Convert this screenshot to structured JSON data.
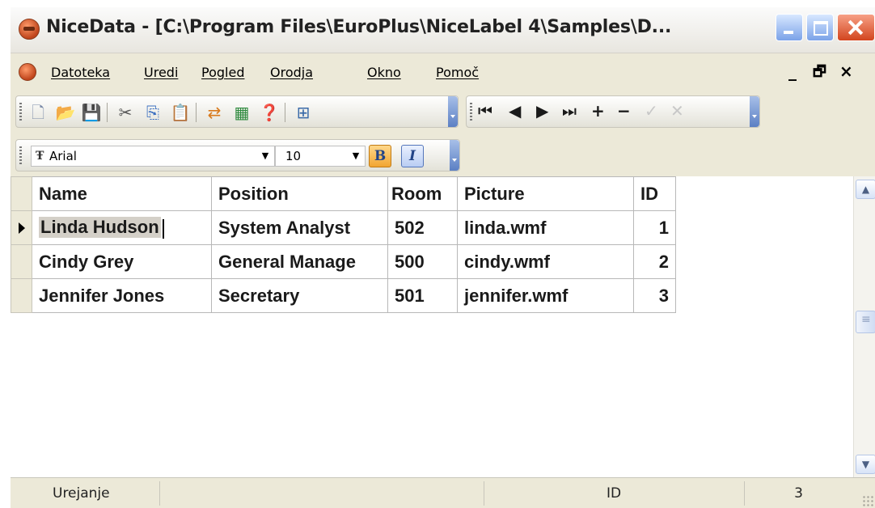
{
  "window": {
    "title": "NiceData - [C:\\Program Files\\EuroPlus\\NiceLabel 4\\Samples\\D..."
  },
  "menu": {
    "items": [
      "Datoteka",
      "Uredi",
      "Pogled",
      "Orodja",
      "Okno",
      "Pomoč"
    ]
  },
  "mdi_controls": {
    "minimize": "_",
    "restore": "🗗",
    "close": "×"
  },
  "format_toolbar": {
    "font": "Arial",
    "size": "10",
    "bold_label": "B",
    "italic_label": "I"
  },
  "grid": {
    "columns": [
      "Name",
      "Position",
      "Room",
      "Picture",
      "ID"
    ],
    "rows": [
      [
        "Linda Hudson",
        "System Analyst",
        "502",
        "linda.wmf",
        "1"
      ],
      [
        "Cindy Grey",
        "General Manage",
        "500",
        "cindy.wmf",
        "2"
      ],
      [
        "Jennifer Jones",
        "Secretary",
        "501",
        "jennifer.wmf",
        "3"
      ]
    ]
  },
  "statusbar": {
    "mode": "Urejanje",
    "field": "ID",
    "record": "3"
  }
}
